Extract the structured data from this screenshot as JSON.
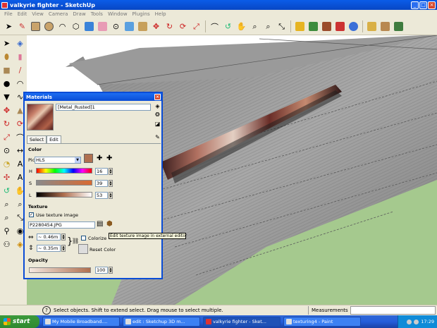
{
  "window": {
    "title": "valkyrie fighter - SketchUp"
  },
  "menu": [
    "File",
    "Edit",
    "View",
    "Camera",
    "Draw",
    "Tools",
    "Window",
    "Plugins",
    "Help"
  ],
  "materials": {
    "title": "Materials",
    "name": "[Metal_Rusted]1",
    "tabs": {
      "select": "Select",
      "edit": "Edit"
    },
    "color_heading": "Color",
    "picker_label": "Picker:",
    "picker_value": "HLS",
    "h_label": "H",
    "h_value": "16",
    "s_label": "S",
    "s_value": "39",
    "l_label": "L",
    "l_value": "53",
    "texture_heading": "Texture",
    "use_texture_label": "Use texture image",
    "texture_file": "P2280454.JPG",
    "tooltip": "Edit texture image in external editor",
    "width_value": "~ 0.46m",
    "height_value": "~ 0.35m",
    "colorize_label": "Colorize",
    "reset_color_label": "Reset Color",
    "opacity_heading": "Opacity",
    "opacity_value": "100",
    "colors": {
      "swatch": "#b07050",
      "dialog_border": "#0a4cd6"
    }
  },
  "status": {
    "message": "Select objects. Shift to extend select. Drag mouse to select multiple.",
    "measurements_label": "Measurements"
  },
  "taskbar": {
    "start_label": "start",
    "tasks": [
      "My Mobile Broadband....",
      "edit : Sketchup 3D m...",
      "valkyrie fighter - Sket...",
      "texturing4 - Paint"
    ],
    "clock": "17:29"
  }
}
